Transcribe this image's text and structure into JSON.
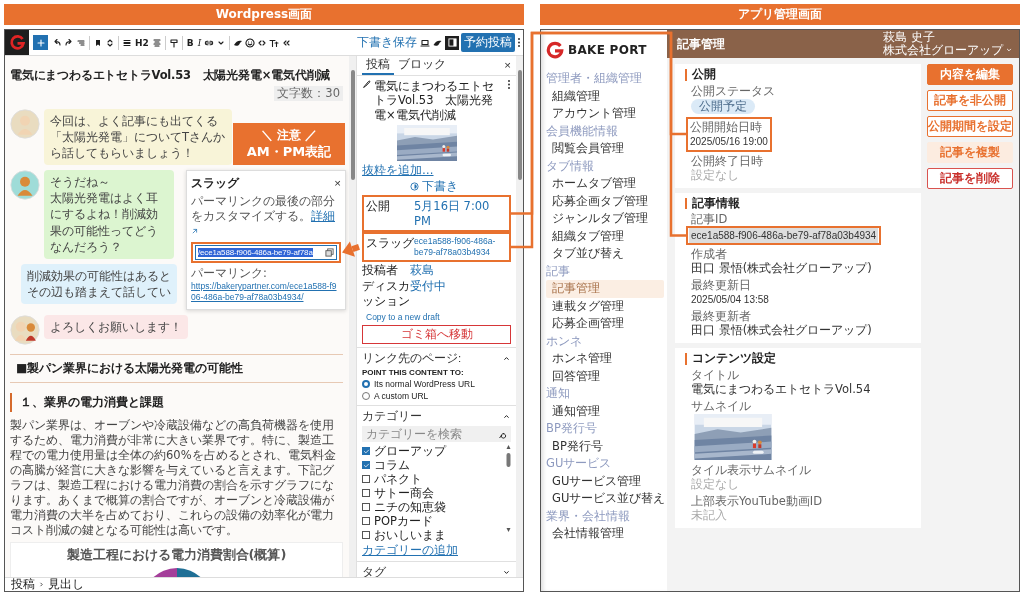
{
  "wp_header": "Wordpress画面",
  "app_header": "アプリ管理画面",
  "wp": {
    "toolbar": {
      "format_labels": [
        "H2",
        "B",
        "I"
      ],
      "save_draft": "下書き保存",
      "schedule_button": "予約投稿"
    },
    "editor": {
      "title": "電気にまつわるエトセトラVol.53　太陽光発電×電気代削減",
      "char_count": "文字数：30",
      "bubbles": [
        {
          "kind": "left",
          "color": "#f8f4d8",
          "lines": [
            "今回は、よく記事にも出てくる「太陽光発電」についてTさんから話してもらいましょう！"
          ]
        },
        {
          "kind": "left",
          "color": "#dcf5d0",
          "lines": [
            "そうだね～",
            "太陽光発電はよく耳にするよね！削減効果の可能性ってどうなんだろう？"
          ]
        },
        {
          "kind": "right",
          "color": "#dff1fb",
          "lines": [
            "削減効果の可能性はあると",
            "その辺も踏まえて話してい"
          ]
        },
        {
          "kind": "left",
          "color": "#fbe7e7",
          "lines": [
            "よろしくお願いします！"
          ]
        }
      ],
      "heading2": "■製パン業界における太陽光発電の可能性",
      "heading3": "１、業界の電力消費と課題",
      "paragraph": "製パン業界は、オーブンや冷蔵設備などの高負荷機器を使用するため、電力消費が非常に大きい業界です。特に、製造工程での電力使用量は全体の約60%を占めるとされ、電気料金の高騰が経営に大きな影響を与えていると言えます。下記グラフは、製造工程における電力消費の割合を示すグラフになります。あくまで概算の割合ですが、オーブンと冷蔵設備が電力消費の大半を占めており、これらの設備の効率化が電力コスト削減の鍵となる可能性は高いです。",
      "chart_title": "製造工程における電力消費割合(概算)"
    },
    "slug_popover": {
      "title": "スラッグ",
      "close": "×",
      "description": "パーマリンクの最後の部分をカスタマイズする。",
      "details_link": "詳細",
      "value": "/ece1a588-f906-486a-be79-af78a",
      "highlighted": true,
      "permalink_label": "パーマリンク:",
      "permalink": "https://bakerypartner.com/ece1a588-f906-486a-be79-af78a03b4934/"
    },
    "sidebar": {
      "tabs": [
        {
          "label": "投稿",
          "selected": true
        },
        {
          "label": "ブロック",
          "selected": false
        }
      ],
      "close": "×",
      "post_title": "電気にまつわるエトセトラVol.53　太陽光発電×電気代削減",
      "excerpt_link": "抜粋を追加…",
      "status": "下書き",
      "rows": [
        {
          "label": "公開",
          "value": "5月16日 7:00 PM",
          "highlighted": true
        },
        {
          "label": "スラッグ",
          "value": "ece1a588-f906-486a-be79-af78a03b4934",
          "highlighted": true
        },
        {
          "label": "投稿者",
          "value": "萩島",
          "highlighted": false
        },
        {
          "label": "ディスカッション",
          "value": "受付中",
          "highlighted": false
        }
      ],
      "copy_link": "Copy to a new draft",
      "trash_button": "ゴミ箱へ移動",
      "link_panel": {
        "title": "リンク先のページ:",
        "expanded": true,
        "caption": "POINT THIS CONTENT TO:",
        "options": [
          {
            "label": "Its normal WordPress URL",
            "selected": true
          },
          {
            "label": "A custom URL",
            "selected": false
          }
        ]
      },
      "category_panel": {
        "title": "カテゴリー",
        "expanded": true,
        "search_placeholder": "カテゴリーを検索",
        "items": [
          {
            "label": "グローアップ",
            "checked": true
          },
          {
            "label": "コラム",
            "checked": true
          },
          {
            "label": "パネクト",
            "checked": false
          },
          {
            "label": "サトー商会",
            "checked": false
          },
          {
            "label": "ニチの知恵袋",
            "checked": false
          },
          {
            "label": "POPカード",
            "checked": false
          },
          {
            "label": "おいしいまま",
            "checked": false
          }
        ],
        "add_link": "カテゴリーの追加"
      },
      "tag_panel": {
        "title": "タグ",
        "expanded": false
      }
    },
    "breadcrumb": [
      "投稿",
      "見出し"
    ]
  },
  "callout": {
    "lines": [
      "＼ 注意 ／",
      "AM・PM表記"
    ]
  },
  "app": {
    "logo": "BAKE PORT",
    "nav": [
      {
        "group": "管理者・組織管理",
        "items": [
          {
            "label": "組織管理",
            "selected": false
          },
          {
            "label": "アカウント管理",
            "selected": false
          }
        ]
      },
      {
        "group": "会員機能情報",
        "items": [
          {
            "label": "閲覧会員管理",
            "selected": false
          }
        ]
      },
      {
        "group": "タブ情報",
        "items": [
          {
            "label": "ホームタブ管理",
            "selected": false
          },
          {
            "label": "応募企画タブ管理",
            "selected": false
          },
          {
            "label": "ジャンルタブ管理",
            "selected": false
          },
          {
            "label": "組織タブ管理",
            "selected": false
          },
          {
            "label": "タブ並び替え",
            "selected": false
          }
        ]
      },
      {
        "group": "記事",
        "items": [
          {
            "label": "記事管理",
            "selected": true
          },
          {
            "label": "連載タグ管理",
            "selected": false
          },
          {
            "label": "応募企画管理",
            "selected": false
          }
        ]
      },
      {
        "group": "ホンネ",
        "items": [
          {
            "label": "ホンネ管理",
            "selected": false
          },
          {
            "label": "回答管理",
            "selected": false
          }
        ]
      },
      {
        "group": "通知",
        "items": [
          {
            "label": "通知管理",
            "selected": false
          }
        ]
      },
      {
        "group": "BP発行号",
        "items": [
          {
            "label": "BP発行号",
            "selected": false
          }
        ]
      },
      {
        "group": "GUサービス",
        "items": [
          {
            "label": "GUサービス管理",
            "selected": false
          },
          {
            "label": "GUサービス並び替え",
            "selected": false
          }
        ]
      },
      {
        "group": "業界・会社情報",
        "items": [
          {
            "label": "会社情報管理",
            "selected": false
          }
        ]
      }
    ],
    "page_title": "記事管理",
    "user": {
      "name": "萩島 史子",
      "company": "株式会社グローアップ"
    },
    "cards": [
      {
        "title": "公開",
        "fields": [
          {
            "label": "公開ステータス",
            "kind": "badge",
            "value": "公開予定",
            "highlight_label": false,
            "highlight_value": false
          },
          {
            "label": "公開開始日時",
            "kind": "text",
            "value": "2025/05/16 19:00",
            "highlight_label": true,
            "highlight_value": true
          },
          {
            "label": "公開終了日時",
            "kind": "empty",
            "value": "設定なし",
            "highlight_label": false,
            "highlight_value": false
          }
        ]
      },
      {
        "title": "記事情報",
        "fields": [
          {
            "label": "記事ID",
            "kind": "text",
            "value": "ece1a588-f906-486a-be79-af78a03b4934",
            "highlight_label": false,
            "highlight_value": true
          },
          {
            "label": "作成者",
            "kind": "text",
            "value": "田口 景悟(株式会社グローアップ)",
            "highlight_label": false,
            "highlight_value": false
          },
          {
            "label": "最終更新日",
            "kind": "text",
            "value": "2025/05/04 13:58",
            "highlight_label": false,
            "highlight_value": false
          },
          {
            "label": "最終更新者",
            "kind": "text",
            "value": "田口 景悟(株式会社グローアップ)",
            "highlight_label": false,
            "highlight_value": false
          }
        ]
      },
      {
        "title": "コンテンツ設定",
        "fields": [
          {
            "label": "タイトル",
            "kind": "text",
            "value": "電気にまつわるエトセトラVol.54",
            "highlight_label": false,
            "highlight_value": false
          },
          {
            "label": "サムネイル",
            "kind": "picture",
            "highlight_label": false,
            "highlight_value": false
          },
          {
            "label": "タイル表示サムネイル",
            "kind": "empty",
            "value": "設定なし",
            "highlight_label": false,
            "highlight_value": false
          },
          {
            "label": "上部表示YouTube動画ID",
            "kind": "empty",
            "value": "未記入",
            "highlight_label": false,
            "highlight_value": false
          }
        ]
      }
    ],
    "actions": [
      {
        "label": "内容を編集",
        "kind": "primary"
      },
      {
        "label": "記事を非公開",
        "kind": "outline"
      },
      {
        "label": "公開期間を設定",
        "kind": "outline"
      },
      {
        "label": "記事を複製",
        "kind": "soft"
      },
      {
        "label": "記事を削除",
        "kind": "danger"
      }
    ]
  }
}
